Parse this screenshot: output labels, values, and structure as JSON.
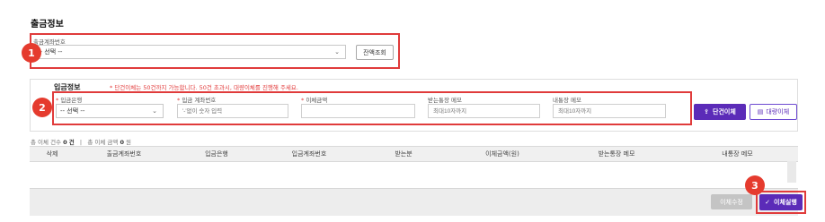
{
  "colors": {
    "accent": "#5b2bb8",
    "highlight": "#e03b3b",
    "marker": "#e53b2e"
  },
  "withdrawal": {
    "title": "출금정보",
    "account_label": "출금계좌번호",
    "account_value": "-- 선택 --",
    "balance_button": "잔액조회"
  },
  "deposit": {
    "title": "입금정보",
    "notice": "* 단건이체는 50건까지 가능합니다. 50건 초과시, 대량이체를 진행해 주세요.",
    "bank_label": "입금은행",
    "bank_value": "-- 선택 --",
    "account_label": "입금 계좌번호",
    "account_placeholder": "'-'없이 숫자 입력",
    "amount_label": "이체금액",
    "recv_memo_label": "받는통장 메모",
    "recv_memo_placeholder": "최대10자까지",
    "my_memo_label": "내통장 메모",
    "my_memo_placeholder": "최대10자까지",
    "single_button": "단건이체",
    "bulk_button": "대량이체"
  },
  "summary": {
    "count_label": "총 이체 건수",
    "count_value": "0",
    "count_unit": "건",
    "amount_label": "총 이체 금액",
    "amount_value": "0",
    "amount_unit": "원"
  },
  "table": {
    "columns": [
      "삭제",
      "출금계좌번호",
      "입금은행",
      "입금계좌번호",
      "받는분",
      "이체금액(원)",
      "받는통장 메모",
      "내통장 메모"
    ]
  },
  "footer": {
    "edit_button": "이체수정",
    "execute_button": "이체실행"
  },
  "markers": [
    "1",
    "2",
    "3"
  ],
  "icons": {
    "select": "chevron-down-icon",
    "single": "transfer-icon",
    "bulk": "document-icon",
    "execute": "check-icon"
  }
}
